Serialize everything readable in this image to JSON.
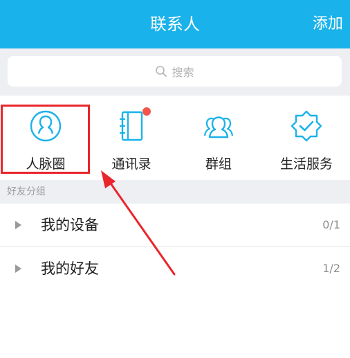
{
  "header": {
    "title": "联系人",
    "add_label": "添加"
  },
  "search": {
    "placeholder": "搜索"
  },
  "grid": {
    "items": [
      {
        "label": "人脉圈",
        "icon": "contacts-circle-icon"
      },
      {
        "label": "通讯录",
        "icon": "address-book-icon"
      },
      {
        "label": "群组",
        "icon": "group-icon"
      },
      {
        "label": "生活服务",
        "icon": "life-service-icon"
      }
    ]
  },
  "section": {
    "title": "好友分组"
  },
  "groups": [
    {
      "name": "我的设备",
      "count": "0/1"
    },
    {
      "name": "我的好友",
      "count": "1/2"
    }
  ],
  "colors": {
    "accent": "#1ab2ea",
    "highlight": "#e8262b",
    "badge": "#f4554b"
  }
}
